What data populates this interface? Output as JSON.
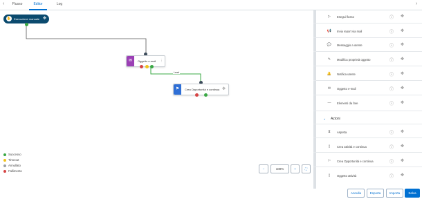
{
  "tabs": [
    {
      "label": "Flusso"
    },
    {
      "label": "Editor"
    },
    {
      "label": "Log"
    }
  ],
  "nav": {
    "prev": "‹",
    "next": "›"
  },
  "nodes": {
    "start": {
      "label": "Esecuzione manuale"
    },
    "email": {
      "label": "Oggetto e-mail"
    },
    "opp": {
      "label": "Crea Opportunità e continua"
    }
  },
  "edge_label": "Lead",
  "legend": [
    {
      "label": "Successo",
      "color": "#3aa844"
    },
    {
      "label": "Timeout",
      "color": "#f1c21b"
    },
    {
      "label": "Annullato",
      "color": "#9aa0a6"
    },
    {
      "label": "Fallimento",
      "color": "#d64545"
    }
  ],
  "zoom": {
    "minus": "−",
    "value": "100%",
    "plus": "+",
    "fit": "⛶"
  },
  "panel": {
    "triggers": [
      {
        "label": "Esegui flusso",
        "icon": "play-icon"
      },
      {
        "label": "Invia report via mail",
        "icon": "megaphone-icon"
      },
      {
        "label": "Messaggio a utente",
        "icon": "chat-icon"
      },
      {
        "label": "Modifica proprietà oggetto",
        "icon": "edit-icon"
      },
      {
        "label": "Notifica utente",
        "icon": "bell-icon"
      },
      {
        "label": "Oggetto e-mail",
        "icon": "mail-icon"
      },
      {
        "label": "Elementi da fare",
        "icon": "dash-icon"
      }
    ],
    "section": "Azioni",
    "actions": [
      {
        "label": "Aspetta",
        "icon": "hourglass-icon"
      },
      {
        "label": "Crea attività e continua",
        "icon": "doc-icon"
      },
      {
        "label": "Crea Opportunità e continua",
        "icon": "flag-icon"
      },
      {
        "label": "Oggetto attività",
        "icon": "doc-icon"
      }
    ]
  },
  "buttons": {
    "annulla": "Annulla",
    "esporta": "Esporta",
    "importa": "Importa",
    "salva": "Salva"
  },
  "colors": {
    "accent": "#0070d2",
    "start_node": "#0b4a6e",
    "email_icon": "#9b3fb5",
    "opp_icon": "#2f6fd6",
    "connector": "#3aa844"
  }
}
